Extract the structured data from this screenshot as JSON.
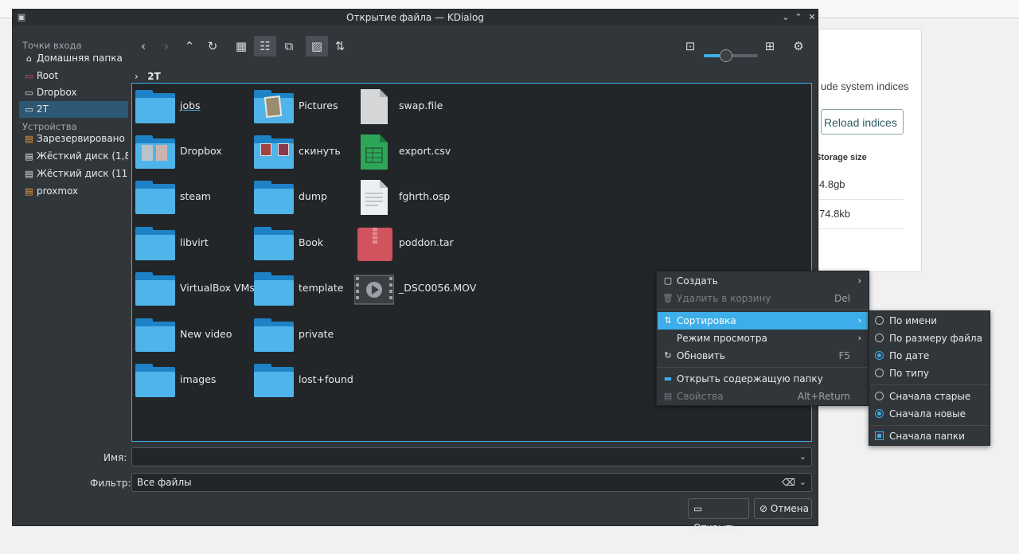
{
  "background": {
    "desc_text": "ude system indices",
    "reload_button": "Reload indices",
    "table_header": "Storage size",
    "rows": [
      "4.8gb",
      "74.8kb"
    ]
  },
  "dialog": {
    "title": "Открытие файла — KDialog",
    "places": {
      "section_entry": "Точки входа",
      "entry_items": [
        {
          "label": "Домашняя папка",
          "icon": "home-icon"
        },
        {
          "label": "Root",
          "icon": "root-folder-icon"
        },
        {
          "label": "Dropbox",
          "icon": "folder-icon"
        },
        {
          "label": "2T",
          "icon": "folder-icon",
          "selected": true
        }
      ],
      "section_devices": "Устройства",
      "device_items": [
        {
          "label": "Зарезервировано ...",
          "icon": "drive-warning-icon"
        },
        {
          "label": "Жёсткий диск (1,8 ...",
          "icon": "harddisk-icon"
        },
        {
          "label": "Жёсткий диск (111...",
          "icon": "harddisk-icon"
        },
        {
          "label": "proxmox",
          "icon": "drive-warning-icon"
        }
      ]
    },
    "breadcrumb": "2T",
    "zoom_level": 0.4,
    "files": {
      "col1": [
        "jobs",
        "Dropbox",
        "steam",
        "libvirt",
        "VirtualBox VMs",
        "New video",
        "images"
      ],
      "col2": [
        "Pictures",
        "скинуть",
        "dump",
        "Book",
        "template",
        "private",
        "lost+found"
      ],
      "col3": [
        "swap.file",
        "export.csv",
        "fghrth.osp",
        "poddon.tar",
        "_DSC0056.MOV"
      ]
    },
    "name_label": "Имя:",
    "name_value": "",
    "filter_label": "Фильтр:",
    "filter_value": "Все файлы",
    "open_button": "Открыть",
    "cancel_button": "Отмена"
  },
  "context_menu": {
    "create": "Создать",
    "trash": "Удалить в корзину",
    "trash_shortcut": "Del",
    "sort": "Сортировка",
    "view_mode": "Режим просмотра",
    "refresh": "Обновить",
    "refresh_shortcut": "F5",
    "open_folder": "Открыть содержащую папку",
    "properties": "Свойства",
    "properties_shortcut": "Alt+Return"
  },
  "sort_menu": {
    "by_name": "По имени",
    "by_size": "По размеру файла",
    "by_date": "По дате",
    "by_type": "По типу",
    "oldest_first": "Сначала старые",
    "newest_first": "Сначала новые",
    "folders_first": "Сначала папки"
  },
  "colors": {
    "accent": "#3daee9",
    "folder": "#4eb4ea",
    "window": "#31363b",
    "view": "#232629"
  }
}
